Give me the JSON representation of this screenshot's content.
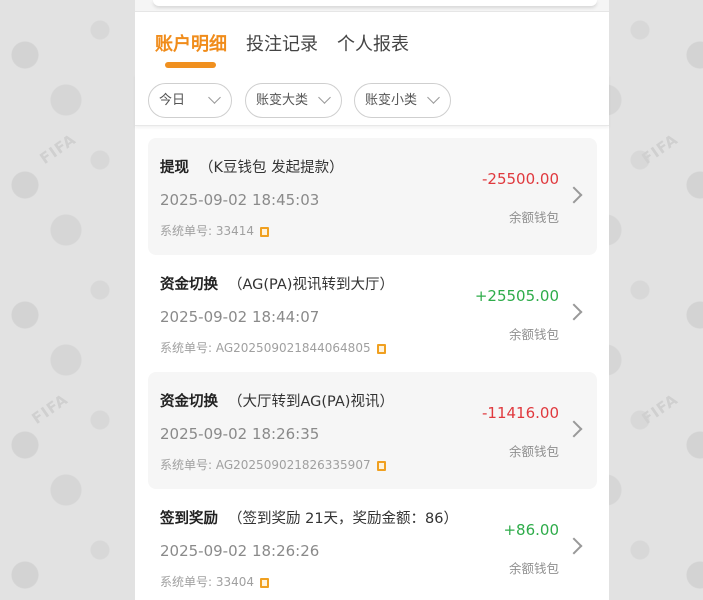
{
  "tabs": [
    {
      "label": "账户明细",
      "active": true
    },
    {
      "label": "投注记录",
      "active": false
    },
    {
      "label": "个人报表",
      "active": false
    }
  ],
  "filters": [
    {
      "label": "今日"
    },
    {
      "label": "账变大类"
    },
    {
      "label": "账变小类"
    }
  ],
  "records": [
    {
      "type": "提现",
      "desc": "（K豆钱包 发起提款）",
      "time": "2025-09-02 18:45:03",
      "order_label": "系统单号: ",
      "order_no": "33414",
      "amount": "-25500.00",
      "wallet": "余额钱包"
    },
    {
      "type": "资金切换",
      "desc": "（AG(PA)视讯转到大厅）",
      "time": "2025-09-02 18:44:07",
      "order_label": "系统单号: ",
      "order_no": "AG202509021844064805",
      "amount": "+25505.00",
      "wallet": "余额钱包"
    },
    {
      "type": "资金切换",
      "desc": "（大厅转到AG(PA)视讯）",
      "time": "2025-09-02 18:26:35",
      "order_label": "系统单号: ",
      "order_no": "AG202509021826335907",
      "amount": "-11416.00",
      "wallet": "余额钱包"
    },
    {
      "type": "签到奖励",
      "desc": "（签到奖励 21天，奖励金额：86）",
      "time": "2025-09-02 18:26:26",
      "order_label": "系统单号: ",
      "order_no": "33404",
      "amount": "+86.00",
      "wallet": "余额钱包"
    }
  ],
  "background": {
    "watermark": "FIFA"
  },
  "colors": {
    "accent": "#f08c1b",
    "negative": "#e0393e",
    "positive": "#2eac4a"
  }
}
